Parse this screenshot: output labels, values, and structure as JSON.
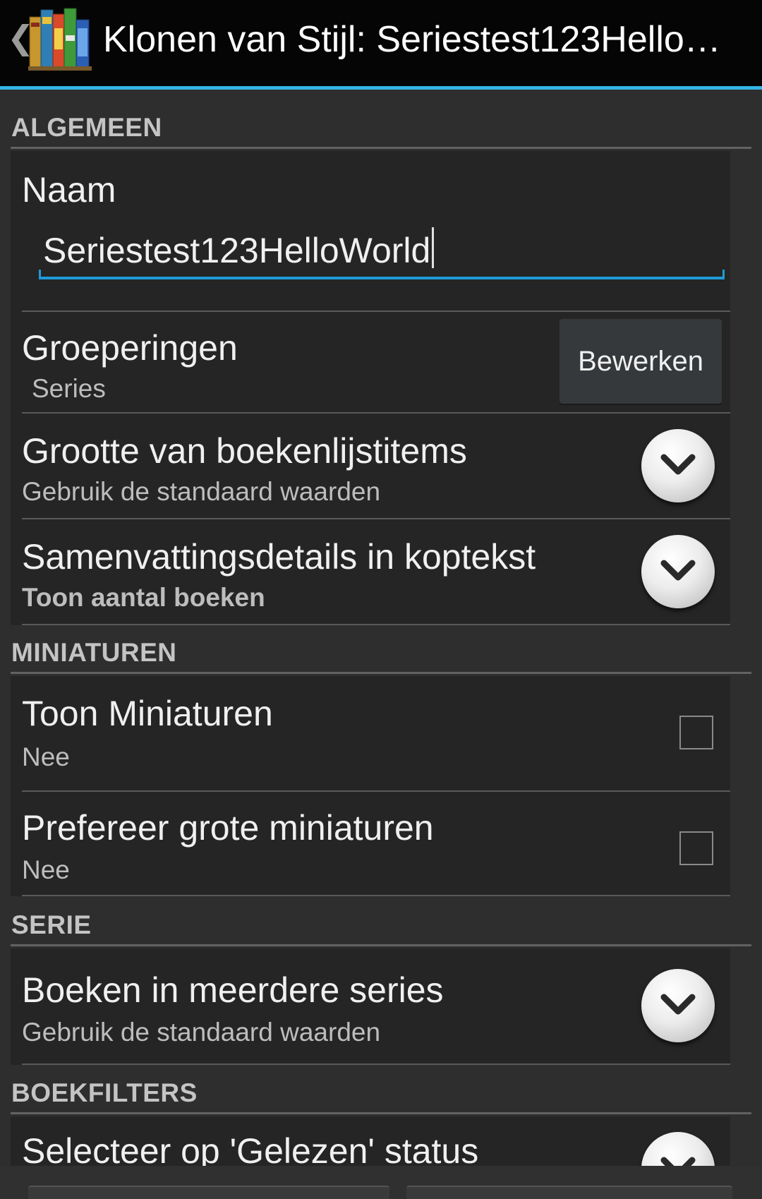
{
  "action_bar": {
    "up_glyph": "❮",
    "title": "Klonen van Stijl: Seriestest123Hello…",
    "icon": "books-app-icon"
  },
  "sections": {
    "algemeen": {
      "header": "ALGEMEEN",
      "naam": {
        "title": "Naam",
        "value": "Seriestest123HelloWorld"
      },
      "groeperingen": {
        "title": "Groeperingen",
        "summary": "Series",
        "button": "Bewerken"
      },
      "grootte": {
        "title": "Grootte van boekenlijstitems",
        "summary": "Gebruik de standaard waarden"
      },
      "samenvatting": {
        "title": "Samenvattingsdetails in koptekst",
        "summary": "Toon aantal boeken"
      }
    },
    "miniaturen": {
      "header": "MINIATUREN",
      "toon": {
        "title": "Toon Miniaturen",
        "summary": "Nee",
        "checked": false
      },
      "grote": {
        "title": "Prefereer grote miniaturen",
        "summary": "Nee",
        "checked": false
      }
    },
    "serie": {
      "header": "SERIE",
      "meerdere": {
        "title": "Boeken in meerdere series",
        "summary": "Gebruik de standaard waarden"
      }
    },
    "boekfilters": {
      "header": "BOEKFILTERS",
      "gelezen": {
        "title": "Selecteer op 'Gelezen' status"
      }
    }
  },
  "colors": {
    "accent": "#33b5e5",
    "background": "#2e2e2e",
    "item_background": "#252525",
    "header_text": "#c4c4c4"
  }
}
